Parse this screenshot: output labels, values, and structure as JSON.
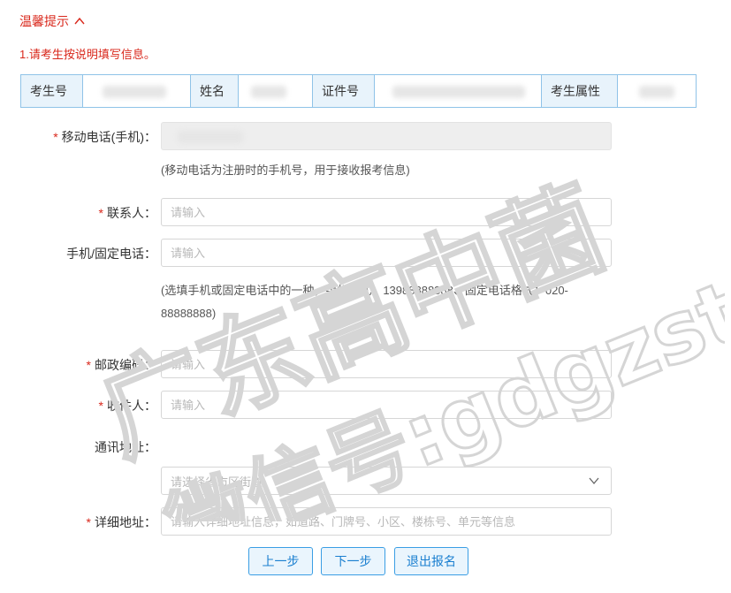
{
  "tips": {
    "header": "温馨提示",
    "caret": "^",
    "line1": "1.请考生按说明填写信息。"
  },
  "info_table": {
    "exam_no_label": "考生号",
    "name_label": "姓名",
    "id_label": "证件号",
    "attr_label": "考生属性"
  },
  "form": {
    "mobile": {
      "required": "*",
      "label": "移动电话(手机)：",
      "hint": "(移动电话为注册时的手机号，用于接收报考信息)"
    },
    "contact": {
      "required": "*",
      "label": "联系人：",
      "placeholder": "请输入"
    },
    "phone": {
      "label": "手机/固定电话：",
      "placeholder": "请输入",
      "hint": "(选填手机或固定电话中的一种，手机格式：13988888888、固定电话格式：020-88888888)"
    },
    "postcode": {
      "required": "*",
      "label": "邮政编码：",
      "placeholder": "请输入"
    },
    "recipient": {
      "required": "*",
      "label": "收件人：",
      "placeholder": "请输入"
    },
    "address_area": {
      "label": "通讯地址：",
      "placeholder": "请选择省市区街道"
    },
    "address_detail": {
      "required": "*",
      "label": "详细地址：",
      "placeholder": "请输入详细地址信息，如道路、门牌号、小区、楼栋号、单元等信息"
    }
  },
  "buttons": {
    "prev": "上一步",
    "next": "下一步",
    "exit": "退出报名"
  },
  "watermark": {
    "line1": "广东高中菌",
    "line2": "微信号:gdgzstu"
  },
  "colors": {
    "accent_red": "#d9281c",
    "table_border": "#8fc3e8",
    "button_blue": "#3a9ee4"
  }
}
